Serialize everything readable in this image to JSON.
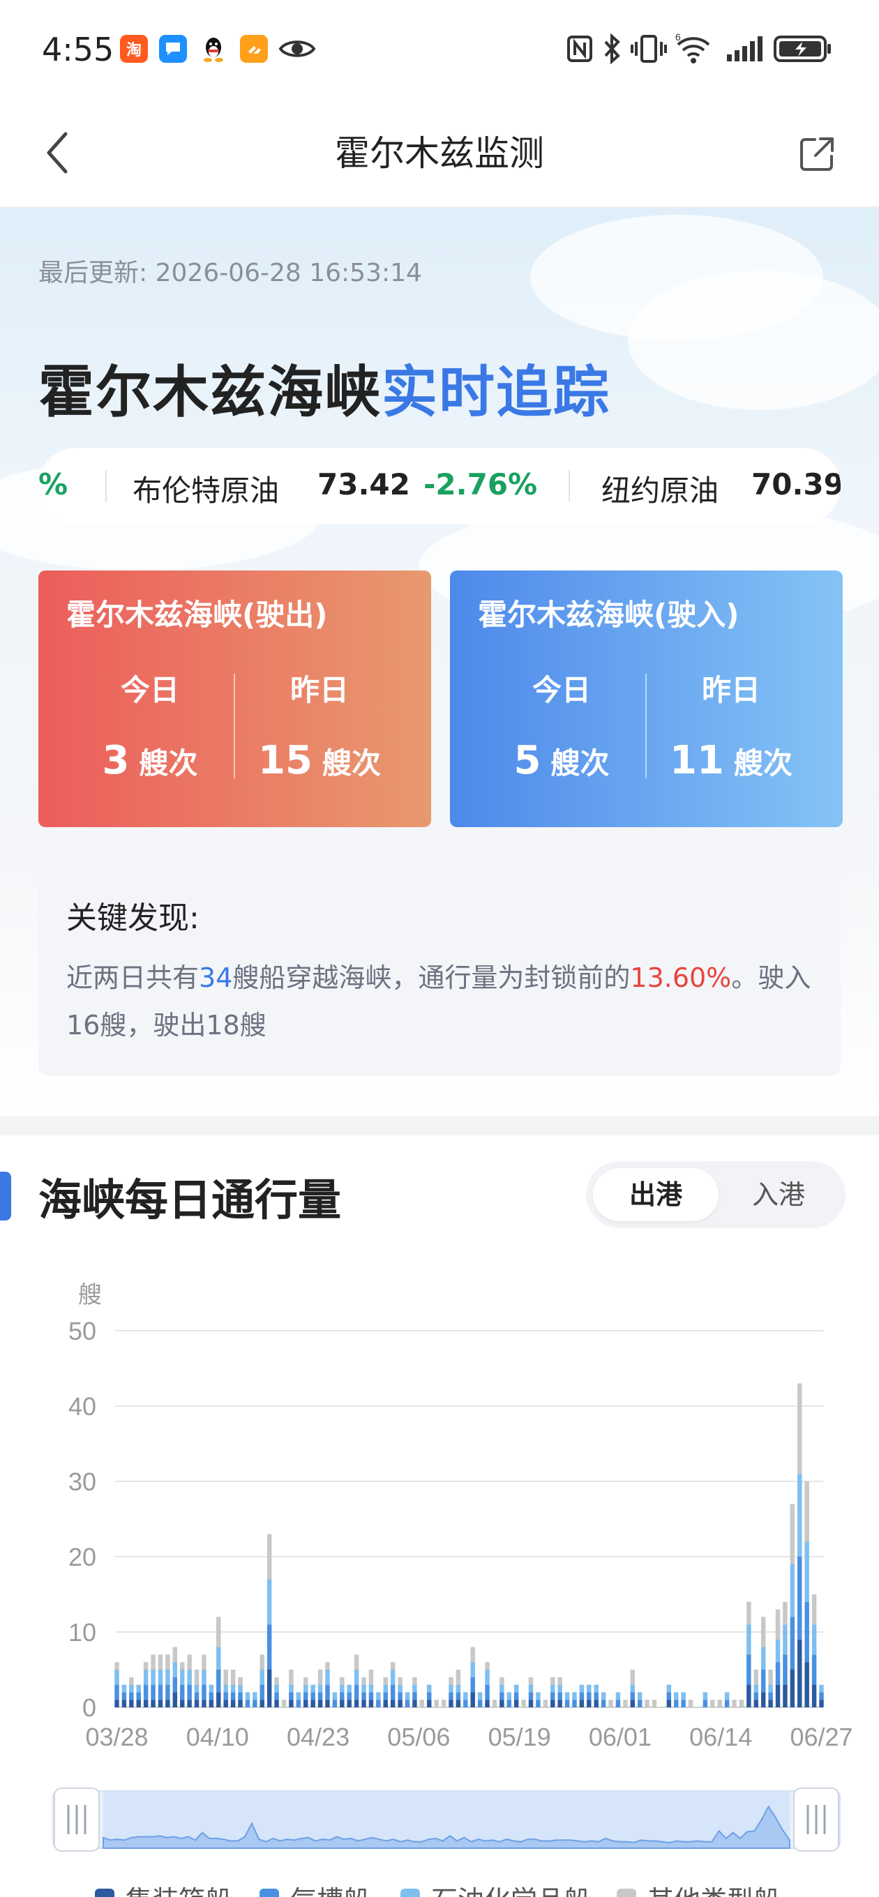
{
  "status_bar": {
    "time": "4:55",
    "app_icons": [
      "taobao-icon",
      "message-icon",
      "qq-icon",
      "tap-icon",
      "eye-icon"
    ],
    "system_icons": [
      "nfc-icon",
      "bluetooth-icon",
      "vibrate-icon",
      "wifi-icon",
      "signal-icon",
      "battery-charging-icon"
    ]
  },
  "nav": {
    "title": "霍尔木兹监测",
    "back_icon": "chevron-left-icon",
    "share_icon": "share-external-icon"
  },
  "hero": {
    "updated": "最后更新: 2026-06-28 16:53:14",
    "headline_prefix": "霍尔木兹海峡",
    "headline_highlight": "实时追踪"
  },
  "ticker": {
    "items": [
      {
        "fragment": "%",
        "color": "#19a15f"
      },
      {
        "name": "布伦特原油",
        "price": "73.42",
        "change": "-2.76%",
        "change_color": "#19a15f"
      },
      {
        "name": "纽约原油",
        "price": "70.39"
      }
    ]
  },
  "cards": [
    {
      "title": "霍尔木兹海峡(驶出)",
      "today_label": "今日",
      "yesterday_label": "昨日",
      "today_value": "3",
      "yesterday_value": "15",
      "unit": "艘次",
      "gradient": [
        "#ec5d5b",
        "#e8996f"
      ]
    },
    {
      "title": "霍尔木兹海峡(驶入)",
      "today_label": "今日",
      "yesterday_label": "昨日",
      "today_value": "5",
      "yesterday_value": "11",
      "unit": "艘次",
      "gradient": [
        "#4d89ea",
        "#85c3f6"
      ]
    }
  ],
  "findings": {
    "title": "关键发现:",
    "text_1": "近两日共有",
    "count": "34",
    "text_2": "艘船穿越海峡，通行量为封锁前的",
    "percent": "13.60%",
    "text_3": "。驶入16艘，驶出18艘"
  },
  "section": {
    "title": "海峡每日通行量",
    "tabs": [
      {
        "label": "出港",
        "active": true
      },
      {
        "label": "入港",
        "active": false
      }
    ]
  },
  "chart_data": {
    "type": "bar",
    "stacked": true,
    "ylabel": "艘",
    "ylim": [
      0,
      50
    ],
    "yticks": [
      0,
      10,
      20,
      30,
      40,
      50
    ],
    "grid": true,
    "x_tick_labels": [
      "03/28",
      "04/10",
      "04/23",
      "05/06",
      "05/19",
      "06/01",
      "06/14",
      "06/27"
    ],
    "x_start": "03/28",
    "x_end": "06/27",
    "legend_position": "bottom",
    "series_colors": [
      "#2c5aa0",
      "#4a90e2",
      "#7fbff0",
      "#c8c8c8"
    ],
    "legend": [
      "集装箱船",
      "气槽船",
      "石油化学品船",
      "其他类型船"
    ],
    "totals": [
      6,
      3,
      4,
      3,
      6,
      7,
      7,
      7,
      8,
      6,
      7,
      5,
      7,
      3,
      12,
      5,
      5,
      4,
      2,
      2,
      7,
      23,
      4,
      1,
      5,
      2,
      4,
      3,
      5,
      6,
      2,
      4,
      3,
      7,
      4,
      5,
      2,
      4,
      6,
      4,
      2,
      4,
      1,
      3,
      1,
      1,
      4,
      5,
      2,
      8,
      2,
      6,
      1,
      4,
      2,
      3,
      1,
      4,
      2,
      1,
      4,
      4,
      2,
      2,
      3,
      3,
      3,
      2,
      1,
      2,
      1,
      5,
      2,
      1,
      1,
      0,
      3,
      2,
      2,
      1,
      0,
      2,
      1,
      1,
      2,
      1,
      1,
      14,
      5,
      12,
      5,
      13,
      14,
      27,
      43,
      30,
      15,
      3
    ]
  },
  "slider": {
    "left_handle": "range-start-handle",
    "right_handle": "range-end-handle"
  }
}
